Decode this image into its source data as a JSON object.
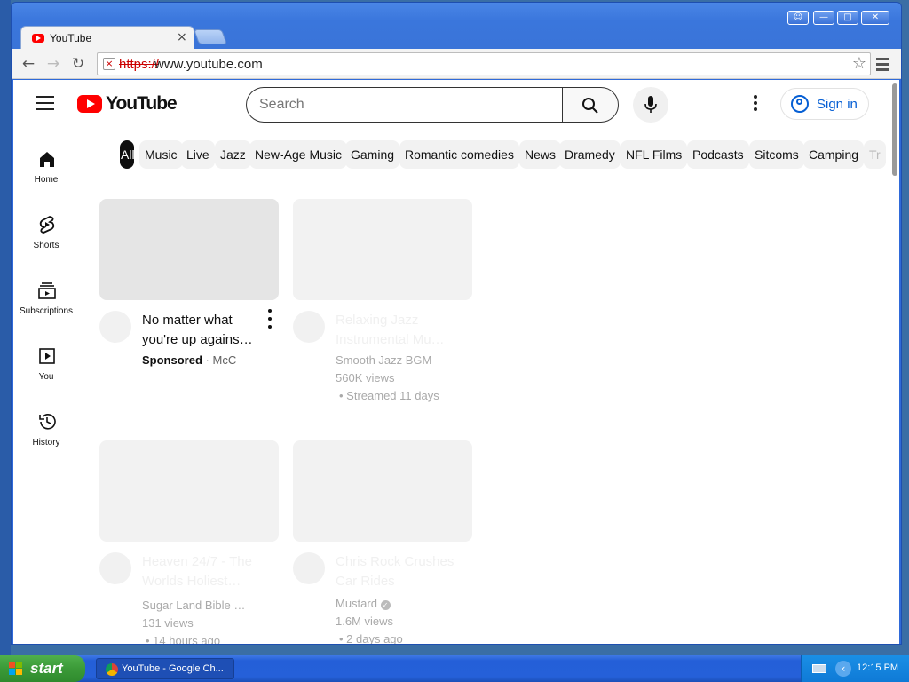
{
  "browser": {
    "tab_title": "YouTube",
    "url_scheme": "https://",
    "url_host": "www.youtube.com"
  },
  "window_controls": [
    "user",
    "minimize",
    "maximize",
    "close"
  ],
  "youtube": {
    "logo_text": "YouTube",
    "search_placeholder": "Search",
    "signin_label": "Sign in",
    "sidebar": [
      {
        "label": "Home",
        "icon": "home-icon"
      },
      {
        "label": "Shorts",
        "icon": "shorts-icon"
      },
      {
        "label": "Subscriptions",
        "icon": "subscriptions-icon"
      },
      {
        "label": "You",
        "icon": "you-icon"
      },
      {
        "label": "History",
        "icon": "history-icon"
      }
    ],
    "chips": [
      "All",
      "Music",
      "Live",
      "Jazz",
      "New-Age Music",
      "Gaming",
      "Romantic comedies",
      "News",
      "Dramedy",
      "NFL Films",
      "Podcasts",
      "Sitcoms",
      "Camping",
      "Tr"
    ],
    "videos": [
      {
        "title": "No matter what you're up agains…",
        "sponsored": "Sponsored",
        "channel": "McC"
      },
      {
        "title": "Relaxing Jazz Instrumental Mu…",
        "channel": "Smooth Jazz BGM",
        "views": "560K views",
        "age": "• Streamed 11 days"
      },
      {
        "title": "Heaven 24/7 - The Worlds Holiest…",
        "channel": "Sugar Land Bible …",
        "views": "131 views",
        "age": "• 14 hours ago"
      },
      {
        "title": "Chris Rock Crushes Car Rides",
        "channel": "Mustard",
        "views": "1.6M views",
        "age": "• 2 days ago"
      }
    ]
  },
  "taskbar": {
    "start_label": "start",
    "task_label": "YouTube - Google Ch...",
    "clock": "12:15 PM"
  },
  "colors": {
    "youtube_red": "#ff0000",
    "link_blue": "#065fd4",
    "xp_blue": "#245fd8",
    "start_green": "#3b9a38"
  }
}
